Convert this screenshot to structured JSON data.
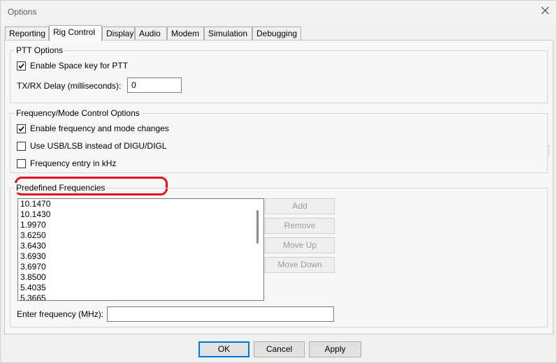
{
  "window": {
    "title": "Options"
  },
  "tabs": [
    {
      "label": "Reporting"
    },
    {
      "label": "Rig Control"
    },
    {
      "label": "Display"
    },
    {
      "label": "Audio"
    },
    {
      "label": "Modem"
    },
    {
      "label": "Simulation"
    },
    {
      "label": "Debugging"
    }
  ],
  "active_tab": "Rig Control",
  "ptt": {
    "group_label": "PTT Options",
    "space_key_label": "Enable Space key for PTT",
    "space_key_checked": true,
    "delay_label": "TX/RX Delay (milliseconds):",
    "delay_value": "0"
  },
  "freq_control": {
    "group_label": "Frequency/Mode Control Options",
    "enable_changes_label": "Enable frequency and mode changes",
    "enable_changes_checked": true,
    "usb_lsb_label": "Use USB/LSB instead of DIGU/DIGL",
    "usb_lsb_checked": false,
    "khz_label": "Frequency entry in kHz",
    "khz_checked": false
  },
  "predefined": {
    "group_label": "Predefined Frequencies",
    "frequencies": [
      "10.1470",
      "10.1430",
      "1.9970",
      "3.6250",
      "3.6430",
      "3.6930",
      "3.6970",
      "3.8500",
      "5.4035",
      "5.3665"
    ],
    "add_label": "Add",
    "remove_label": "Remove",
    "move_up_label": "Move Up",
    "move_down_label": "Move Down",
    "enter_label": "Enter frequency (MHz):",
    "enter_value": ""
  },
  "footer": {
    "ok_label": "OK",
    "cancel_label": "Cancel",
    "apply_label": "Apply"
  },
  "colors": {
    "highlight": "#e0131b",
    "focus": "#0078d7"
  }
}
